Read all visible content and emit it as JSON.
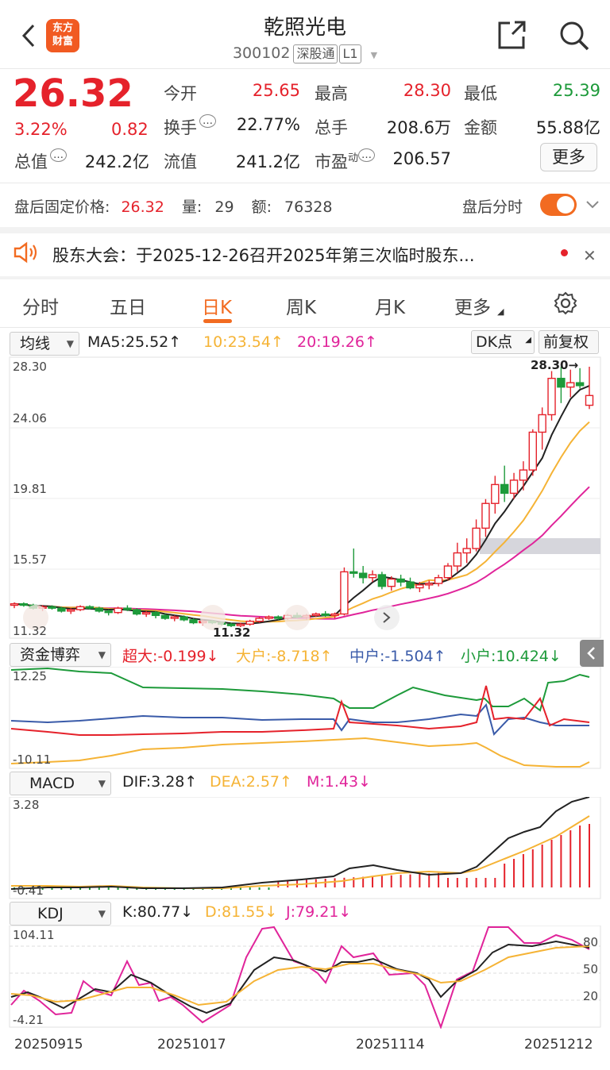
{
  "header": {
    "title": "乾照光电",
    "code": "300102",
    "tag1": "深股通",
    "tag2": "L1",
    "logo_line1": "东方",
    "logo_line2": "财富"
  },
  "quote": {
    "price": "26.32",
    "pct": "3.22%",
    "chg": "0.82",
    "open_label": "今开",
    "open": "25.65",
    "high_label": "最高",
    "high": "28.30",
    "low_label": "最低",
    "low": "25.39",
    "turnover_label": "换手",
    "turnover": "22.77%",
    "vol_label": "总手",
    "vol": "208.6万",
    "amt_label": "金额",
    "amt": "55.88亿",
    "mcap_label": "总值",
    "mcap": "242.2亿",
    "float_label": "流值",
    "float": "241.2亿",
    "pe_label": "市盈",
    "pe_sup": "动",
    "pe": "206.57",
    "more": "更多"
  },
  "afterhours": {
    "label": "盘后固定价格:",
    "price": "26.32",
    "vol_label": "量:",
    "vol": "29",
    "amt_label": "额:",
    "amt": "76328",
    "time_label": "盘后分时"
  },
  "notice": {
    "text": "股东大会：于2025-12-26召开2025年第三次临时股东..."
  },
  "tabs": [
    "分时",
    "五日",
    "日K",
    "周K",
    "月K",
    "更多"
  ],
  "kline": {
    "ma_select": "均线",
    "ma5": "MA5:25.52↑",
    "ma10": "10:23.54↑",
    "ma20": "20:19.26↑",
    "dk": "DK点",
    "fq": "前复权",
    "y_labels": [
      "28.30",
      "24.06",
      "19.81",
      "15.57",
      "11.32"
    ],
    "hi_label": "28.30→",
    "lo_label": "11.32"
  },
  "fund": {
    "select": "资金博弈",
    "super": "超大:-0.199↓",
    "big": "大户:-8.718↑",
    "mid": "中户:-1.504↑",
    "small": "小户:10.424↓",
    "ymax": "12.25",
    "ymin": "-10.11"
  },
  "macd": {
    "select": "MACD",
    "dif": "DIF:3.28↑",
    "dea": "DEA:2.57↑",
    "m": "M:1.43↓",
    "ymax": "3.28",
    "ymin": "-0.41"
  },
  "kdj": {
    "select": "KDJ",
    "k": "K:80.77↓",
    "d": "D:81.55↓",
    "j": "J:79.21↓",
    "ymax": "104.11",
    "ymin": "-4.21",
    "levels": [
      "80",
      "50",
      "20"
    ]
  },
  "dates": [
    "20250915",
    "20251017",
    "20251114",
    "20251212"
  ],
  "colors": {
    "up": "#e5222b",
    "down": "#1d9a3a",
    "ma5": "#222222",
    "ma10": "#f5b335",
    "ma20": "#e0249a",
    "accent": "#f26b21"
  },
  "chart_data": {
    "type": "candlestick",
    "values": [
      [
        11.9,
        12.1,
        11.7,
        12.0
      ],
      [
        12.0,
        12.1,
        11.8,
        11.9
      ],
      [
        11.9,
        12.0,
        11.6,
        11.7
      ],
      [
        11.7,
        11.9,
        11.5,
        11.8
      ],
      [
        11.8,
        11.9,
        11.6,
        11.7
      ],
      [
        11.7,
        11.8,
        11.4,
        11.5
      ],
      [
        11.5,
        11.7,
        11.3,
        11.6
      ],
      [
        11.6,
        11.9,
        11.5,
        11.8
      ],
      [
        11.8,
        11.9,
        11.6,
        11.7
      ],
      [
        11.7,
        11.8,
        11.4,
        11.5
      ],
      [
        11.5,
        11.6,
        11.2,
        11.4
      ],
      [
        11.4,
        11.8,
        11.3,
        11.7
      ],
      [
        11.7,
        11.9,
        11.5,
        11.6
      ],
      [
        11.6,
        11.7,
        11.2,
        11.3
      ],
      [
        11.3,
        11.5,
        11.1,
        11.4
      ],
      [
        11.4,
        11.5,
        11.0,
        11.2
      ],
      [
        11.2,
        11.3,
        10.9,
        11.0
      ],
      [
        11.0,
        11.2,
        10.8,
        11.1
      ],
      [
        11.1,
        11.2,
        10.8,
        10.9
      ],
      [
        10.9,
        11.0,
        10.6,
        10.7
      ],
      [
        10.7,
        10.9,
        10.5,
        10.8
      ],
      [
        10.8,
        10.9,
        10.6,
        10.7
      ],
      [
        10.7,
        10.8,
        10.5,
        10.6
      ],
      [
        10.6,
        10.7,
        10.4,
        10.5
      ],
      [
        10.5,
        10.7,
        10.4,
        10.6
      ],
      [
        10.6,
        10.9,
        10.5,
        10.8
      ],
      [
        10.8,
        11.1,
        10.7,
        11.0
      ],
      [
        11.0,
        11.2,
        10.9,
        11.1
      ],
      [
        11.1,
        11.2,
        10.9,
        11.0
      ],
      [
        11.0,
        11.3,
        10.9,
        11.2
      ],
      [
        11.2,
        11.4,
        11.0,
        11.1
      ],
      [
        11.1,
        11.3,
        10.9,
        11.2
      ],
      [
        11.2,
        11.4,
        11.1,
        11.3
      ],
      [
        11.3,
        11.5,
        11.1,
        11.2
      ],
      [
        11.2,
        11.4,
        11.0,
        11.3
      ],
      [
        11.3,
        14.5,
        11.2,
        14.2
      ],
      [
        14.2,
        15.8,
        13.8,
        14.1
      ],
      [
        14.1,
        14.6,
        13.4,
        13.8
      ],
      [
        13.8,
        14.3,
        13.5,
        14.0
      ],
      [
        14.0,
        14.2,
        13.0,
        13.2
      ],
      [
        13.2,
        13.9,
        12.9,
        13.7
      ],
      [
        13.7,
        14.0,
        13.2,
        13.5
      ],
      [
        13.5,
        13.8,
        13.0,
        13.1
      ],
      [
        13.1,
        13.5,
        12.8,
        13.3
      ],
      [
        13.3,
        13.6,
        13.0,
        13.4
      ],
      [
        13.4,
        14.0,
        13.2,
        13.8
      ],
      [
        13.8,
        14.8,
        13.6,
        14.6
      ],
      [
        14.6,
        16.2,
        14.2,
        15.5
      ],
      [
        15.5,
        16.5,
        14.8,
        15.8
      ],
      [
        15.8,
        17.8,
        15.6,
        17.2
      ],
      [
        17.2,
        19.2,
        16.6,
        18.9
      ],
      [
        18.9,
        20.8,
        18.2,
        20.2
      ],
      [
        20.2,
        21.5,
        19.0,
        19.6
      ],
      [
        19.6,
        21.0,
        19.2,
        20.5
      ],
      [
        20.5,
        21.8,
        19.8,
        21.2
      ],
      [
        21.2,
        24.0,
        20.8,
        23.8
      ],
      [
        23.8,
        25.5,
        22.6,
        25.0
      ],
      [
        25.0,
        28.0,
        24.6,
        27.5
      ],
      [
        27.5,
        28.3,
        25.8,
        26.9
      ],
      [
        26.9,
        28.1,
        26.2,
        27.2
      ],
      [
        27.2,
        28.2,
        26.8,
        27.0
      ],
      [
        25.65,
        28.3,
        25.39,
        26.32
      ]
    ]
  }
}
